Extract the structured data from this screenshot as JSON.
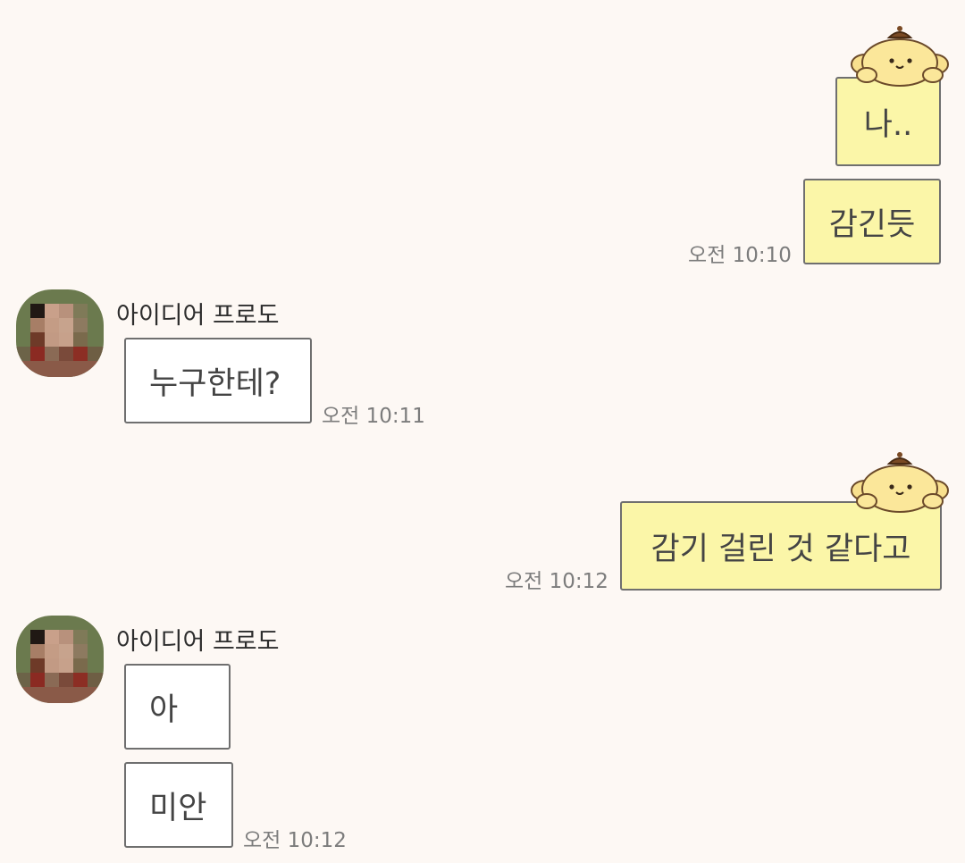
{
  "app": {
    "accent_outgoing_bg": "#fbf6a8",
    "incoming_bg": "#ffffff",
    "page_bg": "#fdf8f4"
  },
  "messages": [
    {
      "direction": "out",
      "text": "나..",
      "sticker": "pompompurin-character-icon"
    },
    {
      "direction": "out",
      "text": "감긴듯",
      "time": "오전 10:10"
    },
    {
      "direction": "in",
      "sender": "아이디어 프로도",
      "text": "누구한테?",
      "time": "오전 10:11"
    },
    {
      "direction": "out",
      "text": "감기 걸린 것 같다고",
      "time": "오전 10:12",
      "sticker": "pompompurin-character-icon"
    },
    {
      "direction": "in",
      "sender": "아이디어 프로도",
      "text": "아"
    },
    {
      "direction": "in",
      "text": "미안",
      "time": "오전 10:12"
    }
  ]
}
